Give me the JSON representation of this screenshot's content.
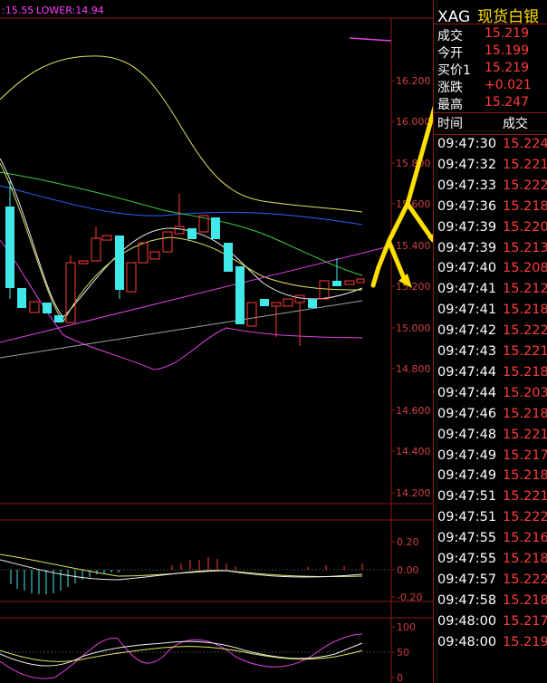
{
  "chart": {
    "boll_label_mid": ":15.55",
    "boll_label_lower": "LOWER:14.94",
    "price_ticks": [
      "16.200",
      "16.000",
      "15.800",
      "15.600",
      "15.400",
      "15.200",
      "15.000",
      "14.800",
      "14.600",
      "14.400",
      "14.200"
    ],
    "macd_ticks": [
      "0.20",
      "0.00",
      "-0.20"
    ],
    "kdj_ticks": [
      "100",
      "50",
      "0"
    ],
    "up_color": "#ff3b3b",
    "down_color": "#40e8e8"
  },
  "quote": {
    "symbol": "XAG",
    "name": "现货白银",
    "fields": [
      {
        "label": "成交",
        "value": "15.219"
      },
      {
        "label": "今开",
        "value": "15.199"
      },
      {
        "label": "买价1",
        "value": "15.219"
      },
      {
        "label": "涨跌",
        "value": "+0.021"
      },
      {
        "label": "最高",
        "value": "15.247"
      }
    ],
    "table_headers": {
      "time": "时间",
      "price": "成交"
    },
    "ticks": [
      {
        "time": "09:47:30",
        "price": "15.224"
      },
      {
        "time": "09:47:32",
        "price": "15.221"
      },
      {
        "time": "09:47:33",
        "price": "15.222"
      },
      {
        "time": "09:47:36",
        "price": "15.218"
      },
      {
        "time": "09:47:39",
        "price": "15.220"
      },
      {
        "time": "09:47:39",
        "price": "15.213"
      },
      {
        "time": "09:47:40",
        "price": "15.208"
      },
      {
        "time": "09:47:41",
        "price": "15.212"
      },
      {
        "time": "09:47:41",
        "price": "15.218"
      },
      {
        "time": "09:47:42",
        "price": "15.222"
      },
      {
        "time": "09:47:43",
        "price": "15.221"
      },
      {
        "time": "09:47:44",
        "price": "15.218"
      },
      {
        "time": "09:47:44",
        "price": "15.203"
      },
      {
        "time": "09:47:46",
        "price": "15.218"
      },
      {
        "time": "09:47:48",
        "price": "15.221"
      },
      {
        "time": "09:47:49",
        "price": "15.217"
      },
      {
        "time": "09:47:49",
        "price": "15.218"
      },
      {
        "time": "09:47:51",
        "price": "15.221"
      },
      {
        "time": "09:47:51",
        "price": "15.222"
      },
      {
        "time": "09:47:55",
        "price": "15.216"
      },
      {
        "time": "09:47:55",
        "price": "15.218"
      },
      {
        "time": "09:47:57",
        "price": "15.222"
      },
      {
        "time": "09:47:58",
        "price": "15.218"
      },
      {
        "time": "09:48:00",
        "price": "15.217"
      },
      {
        "time": "09:48:00",
        "price": "15.219"
      }
    ]
  }
}
